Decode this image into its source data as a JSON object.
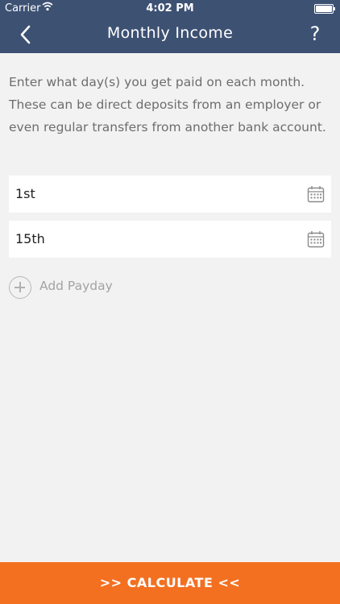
{
  "status_bar": {
    "carrier": "Carrier",
    "time": "4:02 PM"
  },
  "nav": {
    "title": "Monthly Income",
    "help": "?"
  },
  "intro": "Enter what day(s) you get paid on each month. These can be direct deposits from an employer or even regular transfers from another bank account.",
  "paydays": [
    {
      "value": "1st"
    },
    {
      "value": "15th"
    }
  ],
  "add_payday_label": "Add Payday",
  "calculate_label": ">> CALCULATE <<",
  "colors": {
    "nav": "#3d5173",
    "accent": "#f37021",
    "background": "#f2f2f2"
  }
}
